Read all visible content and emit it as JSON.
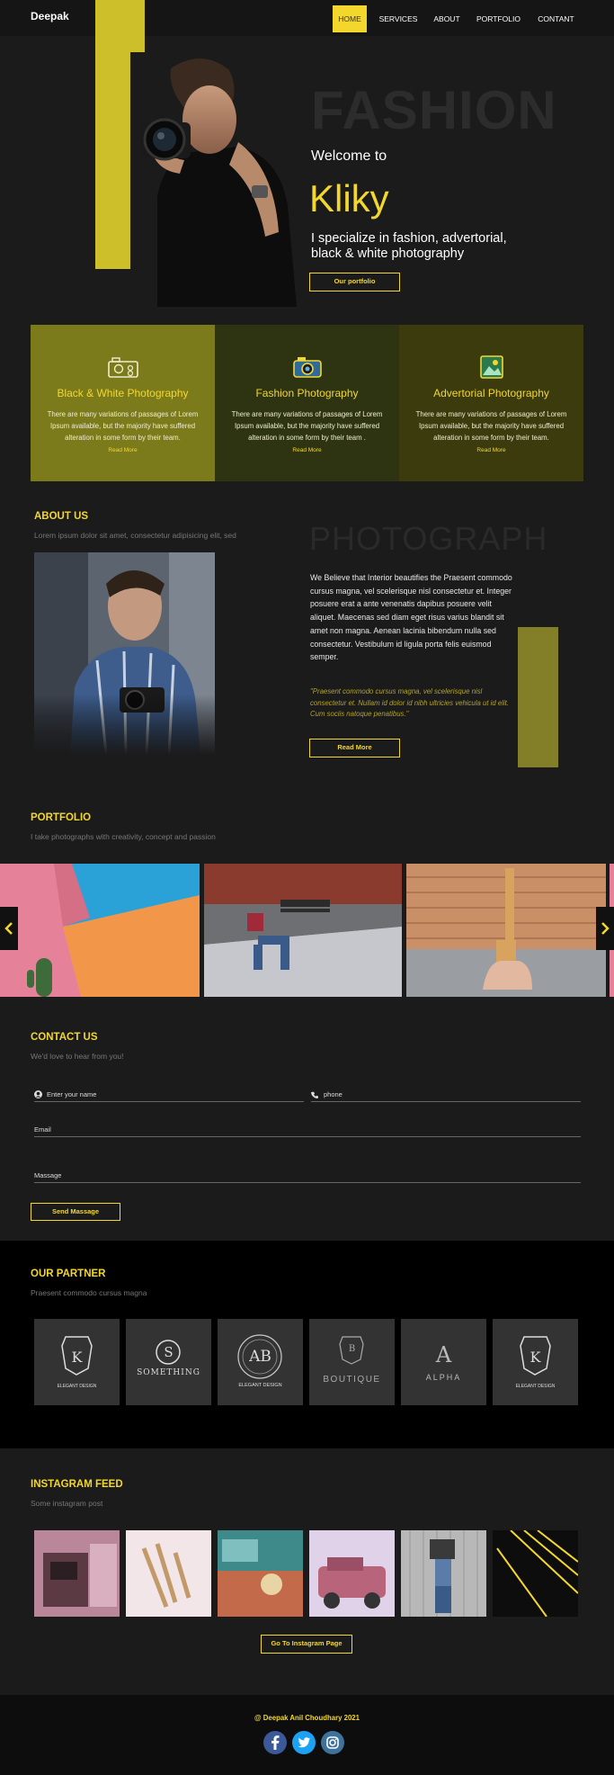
{
  "header": {
    "brand": "Deepak",
    "nav": [
      {
        "label": "HOME"
      },
      {
        "label": "SERVICES"
      },
      {
        "label": "ABOUT"
      },
      {
        "label": "PORTFOLIO"
      },
      {
        "label": "CONTANT"
      }
    ]
  },
  "hero": {
    "bg_word": "FASHION",
    "welcome": "Welcome to",
    "name": "Kliky",
    "tagline": "I specialize in fashion, advertorial, black & white photography",
    "button": "Our portfolio"
  },
  "services": [
    {
      "title": "Black & White Photography",
      "text": "There are many variations of passages of Lorem Ipsum available, but the majority have suffered alteration in some form by their team.",
      "link": "Read More",
      "icon": "camera-icon",
      "bg": "#7b7b1b"
    },
    {
      "title": "Fashion Photography",
      "text": "There are many variations of passages of Lorem Ipsum available, but the majority have suffered alteration in some form by their team .",
      "link": "Read More",
      "icon": "camera-icon",
      "bg": "#2e3412"
    },
    {
      "title": "Advertorial Photography",
      "text": "There are many variations of passages of Lorem Ipsum available, but the majority have suffered alteration in some form by their team.",
      "link": "Read More",
      "icon": "image-icon",
      "bg": "#3c3b0e"
    }
  ],
  "about": {
    "title": "ABOUT US",
    "subtitle": "Lorem ipsum dolor sit amet, consectetur adipisicing elit, sed",
    "bg_word": "PHOTOGRAPH",
    "body": "We Believe that Interior beautifies the Praesent commodo cursus magna, vel scelerisque nisl consectetur et. Integer posuere erat a ante venenatis dapibus posuere velit aliquet. Maecenas sed diam eget risus varius blandit sit amet non magna. Aenean lacinia bibendum nulla sed consectetur. Vestibulum id ligula porta felis euismod semper.",
    "quote": "\"Praesent commodo cursus magna, vel scelerisque nisl consectetur et. Nullam id dolor id nibh ultricies vehicula ut id elit. Cum sociis natoque penatibus.\"",
    "button": "Read More"
  },
  "portfolio": {
    "title": "PORTFOLIO",
    "subtitle": "I take photographs with creativity, concept and passion"
  },
  "contact": {
    "title": "CONTACT US",
    "subtitle": "We'd love to hear from you!",
    "name_placeholder": "Enter your name",
    "phone_placeholder": "phone",
    "email_placeholder": "Email",
    "message_placeholder": "Massage",
    "button": "Send Massage"
  },
  "partner": {
    "title": "OUR PARTNER",
    "subtitle": "Praesent commodo cursus magna",
    "logos": [
      {
        "mark": "K",
        "caption": "ELEGANT DESIGN"
      },
      {
        "mark": "S",
        "caption": "SOMETHING"
      },
      {
        "mark": "AB",
        "caption": "ELEGANT DESIGN"
      },
      {
        "mark": "B",
        "caption": "BOUTIQUE"
      },
      {
        "mark": "A",
        "caption": "ALPHA"
      },
      {
        "mark": "K",
        "caption": "ELEGANT DESIGN"
      }
    ]
  },
  "instagram": {
    "title": "INSTAGRAM FEED",
    "subtitle": "Some instagram post",
    "button": "Go To Instagram Page"
  },
  "footer": {
    "copyright": "@ Deepak Anil Choudhary 2021",
    "social": [
      "facebook-icon",
      "twitter-icon",
      "instagram-icon"
    ]
  },
  "colors": {
    "accent": "#f3d72d",
    "dark": "#1b1b1b"
  }
}
